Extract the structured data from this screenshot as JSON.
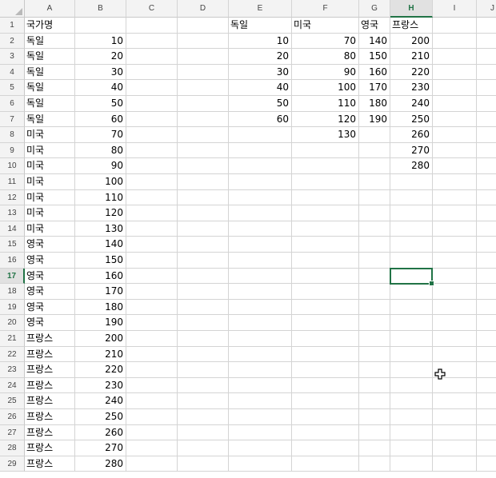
{
  "sheet": {
    "columns": [
      "A",
      "B",
      "C",
      "D",
      "E",
      "F",
      "G",
      "H",
      "I",
      "J"
    ],
    "active_column": "H",
    "active_row": 17,
    "first_row": 1,
    "row_count": 29,
    "cells": {
      "A1": "국가명",
      "A2": "독일",
      "A3": "독일",
      "A4": "독일",
      "A5": "독일",
      "A6": "독일",
      "A7": "독일",
      "A8": "미국",
      "A9": "미국",
      "A10": "미국",
      "A11": "미국",
      "A12": "미국",
      "A13": "미국",
      "A14": "미국",
      "A15": "영국",
      "A16": "영국",
      "A17": "영국",
      "A18": "영국",
      "A19": "영국",
      "A20": "영국",
      "A21": "프랑스",
      "A22": "프랑스",
      "A23": "프랑스",
      "A24": "프랑스",
      "A25": "프랑스",
      "A26": "프랑스",
      "A27": "프랑스",
      "A28": "프랑스",
      "A29": "프랑스",
      "B2": "10",
      "B3": "20",
      "B4": "30",
      "B5": "40",
      "B6": "50",
      "B7": "60",
      "B8": "70",
      "B9": "80",
      "B10": "90",
      "B11": "100",
      "B12": "110",
      "B13": "120",
      "B14": "130",
      "B15": "140",
      "B16": "150",
      "B17": "160",
      "B18": "170",
      "B19": "180",
      "B20": "190",
      "B21": "200",
      "B22": "210",
      "B23": "220",
      "B24": "230",
      "B25": "240",
      "B26": "250",
      "B27": "260",
      "B28": "270",
      "B29": "280",
      "E1": "독일",
      "F1": "미국",
      "G1": "영국",
      "H1": "프랑스",
      "E2": "10",
      "E3": "20",
      "E4": "30",
      "E5": "40",
      "E6": "50",
      "E7": "60",
      "F2": "70",
      "F3": "80",
      "F4": "90",
      "F5": "100",
      "F6": "110",
      "F7": "120",
      "F8": "130",
      "G2": "140",
      "G3": "150",
      "G4": "160",
      "G5": "170",
      "G6": "180",
      "G7": "190",
      "H2": "200",
      "H3": "210",
      "H4": "220",
      "H5": "230",
      "H6": "240",
      "H7": "250",
      "H8": "260",
      "H9": "270",
      "H10": "280"
    },
    "text_cells": [
      "A1",
      "A2",
      "A3",
      "A4",
      "A5",
      "A6",
      "A7",
      "A8",
      "A9",
      "A10",
      "A11",
      "A12",
      "A13",
      "A14",
      "A15",
      "A16",
      "A17",
      "A18",
      "A19",
      "A20",
      "A21",
      "A22",
      "A23",
      "A24",
      "A25",
      "A26",
      "A27",
      "A28",
      "A29",
      "E1",
      "F1",
      "G1",
      "H1"
    ],
    "selected_cell": "H17",
    "accent_color": "#217346",
    "cursor_icon": "crosshair-plus-cursor-icon"
  }
}
